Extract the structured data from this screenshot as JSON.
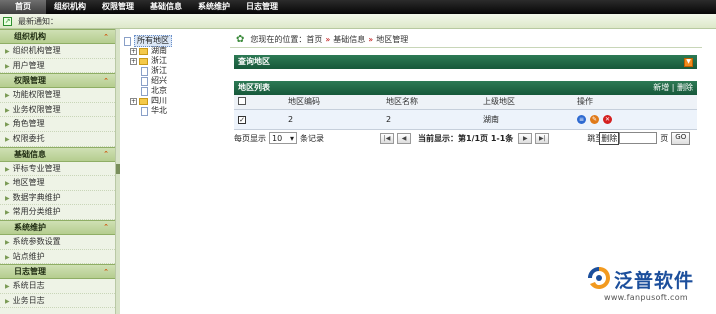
{
  "topnav": {
    "items": [
      "首页",
      "组织机构",
      "权限管理",
      "基础信息",
      "系统维护",
      "日志管理"
    ]
  },
  "notice": {
    "label": "最新通知："
  },
  "sidebar": {
    "groups": [
      {
        "title": "组织机构",
        "items": [
          "组织机构管理",
          "用户管理"
        ]
      },
      {
        "title": "权限管理",
        "items": [
          "功能权限管理",
          "业务权限管理",
          "角色管理",
          "权限委托"
        ]
      },
      {
        "title": "基础信息",
        "items": [
          "评标专业管理",
          "地区管理",
          "数据字典维护",
          "常用分类维护"
        ]
      },
      {
        "title": "系统维护",
        "items": [
          "系统参数设置",
          "站点维护"
        ]
      },
      {
        "title": "日志管理",
        "items": [
          "系统日志",
          "业务日志"
        ]
      }
    ],
    "toggle_glyph": "«"
  },
  "tree": {
    "root": "所有地区",
    "nodes": [
      "湖南",
      "浙江",
      "浙江",
      "绍兴",
      "北京",
      "四川",
      "华北"
    ]
  },
  "breadcrumb": {
    "prefix": "您现在的位置：",
    "items": [
      "首页",
      "基础信息",
      "地区管理"
    ],
    "sep": "»"
  },
  "query_panel": {
    "title": "查询地区"
  },
  "list_panel": {
    "title": "地区列表",
    "add": "新增",
    "sep": "|",
    "delete": "删除"
  },
  "grid": {
    "headers": [
      "",
      "地区编码",
      "地区名称",
      "上级地区",
      "操作"
    ],
    "rows": [
      {
        "checked": true,
        "code": "2",
        "name": "2",
        "parent": "湖南"
      }
    ]
  },
  "pager": {
    "per_page_prefix": "每页显示",
    "per_page_value": "10",
    "per_page_suffix": "条记录",
    "current_label": "当前显示：第1/1页 1-1条",
    "goto_label": "跳至",
    "tooltip": "删除",
    "page_suffix": "页",
    "go": "GO"
  },
  "logo": {
    "brand": "泛普软件",
    "url": "www.fanpusoft.com"
  }
}
